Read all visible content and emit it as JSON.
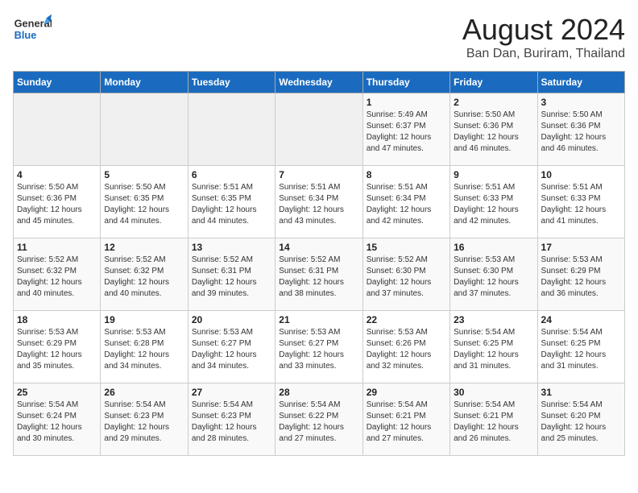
{
  "header": {
    "logo_general": "General",
    "logo_blue": "Blue",
    "month_year": "August 2024",
    "location": "Ban Dan, Buriram, Thailand"
  },
  "weekdays": [
    "Sunday",
    "Monday",
    "Tuesday",
    "Wednesday",
    "Thursday",
    "Friday",
    "Saturday"
  ],
  "weeks": [
    [
      {
        "day": "",
        "info": ""
      },
      {
        "day": "",
        "info": ""
      },
      {
        "day": "",
        "info": ""
      },
      {
        "day": "",
        "info": ""
      },
      {
        "day": "1",
        "info": "Sunrise: 5:49 AM\nSunset: 6:37 PM\nDaylight: 12 hours\nand 47 minutes."
      },
      {
        "day": "2",
        "info": "Sunrise: 5:50 AM\nSunset: 6:36 PM\nDaylight: 12 hours\nand 46 minutes."
      },
      {
        "day": "3",
        "info": "Sunrise: 5:50 AM\nSunset: 6:36 PM\nDaylight: 12 hours\nand 46 minutes."
      }
    ],
    [
      {
        "day": "4",
        "info": "Sunrise: 5:50 AM\nSunset: 6:36 PM\nDaylight: 12 hours\nand 45 minutes."
      },
      {
        "day": "5",
        "info": "Sunrise: 5:50 AM\nSunset: 6:35 PM\nDaylight: 12 hours\nand 44 minutes."
      },
      {
        "day": "6",
        "info": "Sunrise: 5:51 AM\nSunset: 6:35 PM\nDaylight: 12 hours\nand 44 minutes."
      },
      {
        "day": "7",
        "info": "Sunrise: 5:51 AM\nSunset: 6:34 PM\nDaylight: 12 hours\nand 43 minutes."
      },
      {
        "day": "8",
        "info": "Sunrise: 5:51 AM\nSunset: 6:34 PM\nDaylight: 12 hours\nand 42 minutes."
      },
      {
        "day": "9",
        "info": "Sunrise: 5:51 AM\nSunset: 6:33 PM\nDaylight: 12 hours\nand 42 minutes."
      },
      {
        "day": "10",
        "info": "Sunrise: 5:51 AM\nSunset: 6:33 PM\nDaylight: 12 hours\nand 41 minutes."
      }
    ],
    [
      {
        "day": "11",
        "info": "Sunrise: 5:52 AM\nSunset: 6:32 PM\nDaylight: 12 hours\nand 40 minutes."
      },
      {
        "day": "12",
        "info": "Sunrise: 5:52 AM\nSunset: 6:32 PM\nDaylight: 12 hours\nand 40 minutes."
      },
      {
        "day": "13",
        "info": "Sunrise: 5:52 AM\nSunset: 6:31 PM\nDaylight: 12 hours\nand 39 minutes."
      },
      {
        "day": "14",
        "info": "Sunrise: 5:52 AM\nSunset: 6:31 PM\nDaylight: 12 hours\nand 38 minutes."
      },
      {
        "day": "15",
        "info": "Sunrise: 5:52 AM\nSunset: 6:30 PM\nDaylight: 12 hours\nand 37 minutes."
      },
      {
        "day": "16",
        "info": "Sunrise: 5:53 AM\nSunset: 6:30 PM\nDaylight: 12 hours\nand 37 minutes."
      },
      {
        "day": "17",
        "info": "Sunrise: 5:53 AM\nSunset: 6:29 PM\nDaylight: 12 hours\nand 36 minutes."
      }
    ],
    [
      {
        "day": "18",
        "info": "Sunrise: 5:53 AM\nSunset: 6:29 PM\nDaylight: 12 hours\nand 35 minutes."
      },
      {
        "day": "19",
        "info": "Sunrise: 5:53 AM\nSunset: 6:28 PM\nDaylight: 12 hours\nand 34 minutes."
      },
      {
        "day": "20",
        "info": "Sunrise: 5:53 AM\nSunset: 6:27 PM\nDaylight: 12 hours\nand 34 minutes."
      },
      {
        "day": "21",
        "info": "Sunrise: 5:53 AM\nSunset: 6:27 PM\nDaylight: 12 hours\nand 33 minutes."
      },
      {
        "day": "22",
        "info": "Sunrise: 5:53 AM\nSunset: 6:26 PM\nDaylight: 12 hours\nand 32 minutes."
      },
      {
        "day": "23",
        "info": "Sunrise: 5:54 AM\nSunset: 6:25 PM\nDaylight: 12 hours\nand 31 minutes."
      },
      {
        "day": "24",
        "info": "Sunrise: 5:54 AM\nSunset: 6:25 PM\nDaylight: 12 hours\nand 31 minutes."
      }
    ],
    [
      {
        "day": "25",
        "info": "Sunrise: 5:54 AM\nSunset: 6:24 PM\nDaylight: 12 hours\nand 30 minutes."
      },
      {
        "day": "26",
        "info": "Sunrise: 5:54 AM\nSunset: 6:23 PM\nDaylight: 12 hours\nand 29 minutes."
      },
      {
        "day": "27",
        "info": "Sunrise: 5:54 AM\nSunset: 6:23 PM\nDaylight: 12 hours\nand 28 minutes."
      },
      {
        "day": "28",
        "info": "Sunrise: 5:54 AM\nSunset: 6:22 PM\nDaylight: 12 hours\nand 27 minutes."
      },
      {
        "day": "29",
        "info": "Sunrise: 5:54 AM\nSunset: 6:21 PM\nDaylight: 12 hours\nand 27 minutes."
      },
      {
        "day": "30",
        "info": "Sunrise: 5:54 AM\nSunset: 6:21 PM\nDaylight: 12 hours\nand 26 minutes."
      },
      {
        "day": "31",
        "info": "Sunrise: 5:54 AM\nSunset: 6:20 PM\nDaylight: 12 hours\nand 25 minutes."
      }
    ]
  ]
}
